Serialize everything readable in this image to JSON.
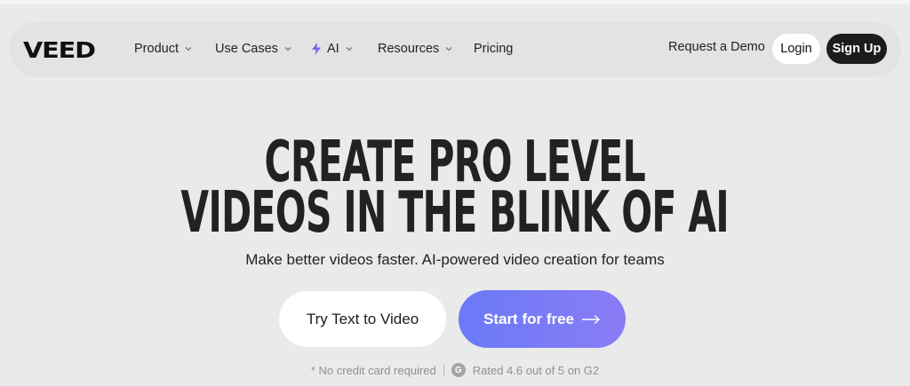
{
  "nav": {
    "logo": "VEED",
    "items": [
      {
        "label": "Product",
        "has_dropdown": true,
        "icon": "chevron-down-icon"
      },
      {
        "label": "Use Cases",
        "has_dropdown": true,
        "icon": "chevron-down-icon"
      },
      {
        "label": "AI",
        "has_dropdown": true,
        "leading_icon": "lightning-bolt-icon",
        "icon": "chevron-down-icon"
      },
      {
        "label": "Resources",
        "has_dropdown": true,
        "icon": "chevron-down-icon"
      },
      {
        "label": "Pricing",
        "has_dropdown": false
      }
    ],
    "request_demo": "Request a Demo",
    "login": "Login",
    "signup": "Sign Up"
  },
  "hero": {
    "headline_line1": "CREATE PRO LEVEL",
    "headline_line2": "VIDEOS IN THE BLINK OF AI",
    "subtitle": "Make better videos faster. AI-powered video creation for teams",
    "primary_button": "Start for free",
    "primary_button_icon": "arrow-right-icon",
    "secondary_button": "Try Text to Video",
    "note_no_card": "* No credit card required",
    "rating_icon": "g2-logo-icon",
    "rating_text": "Rated 4.6 out of 5 on G2"
  },
  "colors": {
    "background": "#e9eaea",
    "nav_background": "#e2e3e3",
    "signup_bg": "#1c1c1c",
    "cta_gradient_start": "#6a7af7",
    "cta_gradient_end": "#8a7cf6",
    "bolt_accent": "#7b5cf0"
  }
}
